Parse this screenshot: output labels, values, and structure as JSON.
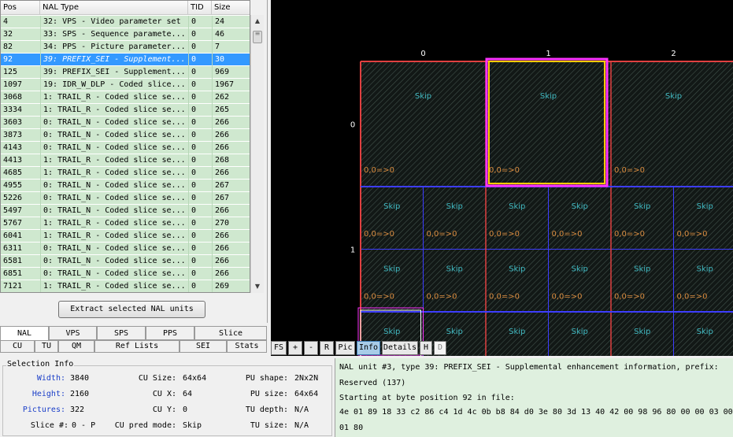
{
  "nal_table": {
    "headers": {
      "pos": "Pos",
      "type": "NAL Type",
      "tid": "TID",
      "size": "Size"
    },
    "rows": [
      {
        "pos": "4",
        "type": "32: VPS - Video parameter set",
        "tid": "0",
        "size": "24",
        "selected": false
      },
      {
        "pos": "32",
        "type": "33: SPS - Sequence paramete...",
        "tid": "0",
        "size": "46",
        "selected": false
      },
      {
        "pos": "82",
        "type": "34: PPS - Picture parameter...",
        "tid": "0",
        "size": "7",
        "selected": false
      },
      {
        "pos": "92",
        "type": "39: PREFIX_SEI - Supplement...",
        "tid": "0",
        "size": "30",
        "selected": true
      },
      {
        "pos": "125",
        "type": "39: PREFIX_SEI - Supplement...",
        "tid": "0",
        "size": "969",
        "selected": false
      },
      {
        "pos": "1097",
        "type": "19: IDR_W_DLP - Coded slice...",
        "tid": "0",
        "size": "1967",
        "selected": false
      },
      {
        "pos": "3068",
        "type": "1: TRAIL_R - Coded slice se...",
        "tid": "0",
        "size": "262",
        "selected": false
      },
      {
        "pos": "3334",
        "type": "1: TRAIL_R - Coded slice se...",
        "tid": "0",
        "size": "265",
        "selected": false
      },
      {
        "pos": "3603",
        "type": "0: TRAIL_N - Coded slice se...",
        "tid": "0",
        "size": "266",
        "selected": false
      },
      {
        "pos": "3873",
        "type": "0: TRAIL_N - Coded slice se...",
        "tid": "0",
        "size": "266",
        "selected": false
      },
      {
        "pos": "4143",
        "type": "0: TRAIL_N - Coded slice se...",
        "tid": "0",
        "size": "266",
        "selected": false
      },
      {
        "pos": "4413",
        "type": "1: TRAIL_R - Coded slice se...",
        "tid": "0",
        "size": "268",
        "selected": false
      },
      {
        "pos": "4685",
        "type": "1: TRAIL_R - Coded slice se...",
        "tid": "0",
        "size": "266",
        "selected": false
      },
      {
        "pos": "4955",
        "type": "0: TRAIL_N - Coded slice se...",
        "tid": "0",
        "size": "267",
        "selected": false
      },
      {
        "pos": "5226",
        "type": "0: TRAIL_N - Coded slice se...",
        "tid": "0",
        "size": "267",
        "selected": false
      },
      {
        "pos": "5497",
        "type": "0: TRAIL_N - Coded slice se...",
        "tid": "0",
        "size": "266",
        "selected": false
      },
      {
        "pos": "5767",
        "type": "1: TRAIL_R - Coded slice se...",
        "tid": "0",
        "size": "270",
        "selected": false
      },
      {
        "pos": "6041",
        "type": "1: TRAIL_R - Coded slice se...",
        "tid": "0",
        "size": "266",
        "selected": false
      },
      {
        "pos": "6311",
        "type": "0: TRAIL_N - Coded slice se...",
        "tid": "0",
        "size": "266",
        "selected": false
      },
      {
        "pos": "6581",
        "type": "0: TRAIL_N - Coded slice se...",
        "tid": "0",
        "size": "266",
        "selected": false
      },
      {
        "pos": "6851",
        "type": "0: TRAIL_N - Coded slice se...",
        "tid": "0",
        "size": "266",
        "selected": false
      },
      {
        "pos": "7121",
        "type": "1: TRAIL_R - Coded slice se...",
        "tid": "0",
        "size": "269",
        "selected": false
      }
    ]
  },
  "extract_button": "Extract selected NAL units",
  "tabs_row1": [
    "NAL",
    "VPS",
    "SPS",
    "PPS",
    "Slice"
  ],
  "tabs_row2": [
    "CU",
    "TU",
    "QM",
    "Ref Lists",
    "SEI",
    "Stats"
  ],
  "active_tab": "NAL",
  "selection_info": {
    "title": "Selection Info",
    "width_label": "Width:",
    "width_value": "3840",
    "height_label": "Height:",
    "height_value": "2160",
    "pictures_label": "Pictures:",
    "pictures_value": "322",
    "slice_label": "Slice #:",
    "slice_value": "0 - P",
    "cu_size_label": "CU Size:",
    "cu_size_value": "64x64",
    "cu_x_label": "CU X:",
    "cu_x_value": "64",
    "cu_y_label": "CU Y:",
    "cu_y_value": "0",
    "cu_pred_label": "CU pred mode:",
    "cu_pred_value": "Skip",
    "pu_shape_label": "PU shape:",
    "pu_shape_value": "2Nx2N",
    "pu_size_label": "PU size:",
    "pu_size_value": "64x64",
    "tu_depth_label": "TU depth:",
    "tu_depth_value": "N/A",
    "tu_size_label": "TU size:",
    "tu_size_value": "N/A"
  },
  "video_view": {
    "col_labels": [
      "0",
      "1",
      "2"
    ],
    "row_labels": [
      "0",
      "1"
    ],
    "cell_text": "Skip",
    "mv_text": "0,0=>0",
    "colors": {
      "ctu_border": "#e04040",
      "cu_border": "#3d3dff",
      "selection_outer": "#ff33ff",
      "selection_inner": "#ffcc00",
      "skip_text": "#40b8c0",
      "mv_text": "#d98c40",
      "hatch": "#40504a"
    }
  },
  "toolbar": [
    "FS",
    "+",
    "-",
    "R",
    "Pic",
    "Info",
    "Details",
    "H",
    "D"
  ],
  "toolbar_active": [
    "Info"
  ],
  "nal_info": {
    "line1": "NAL unit #3, type 39: PREFIX_SEI - Supplemental enhancement information, prefix:",
    "line2": "Reserved (137)",
    "line3": "Starting at byte position 92 in file:",
    "line4": "4e 01 89 18 33 c2 86 c4 1d 4c 0b b8 84 d0 3e 80 3d 13 40 42 00 98 96 80 00 00 03 00",
    "line5": "01 80"
  }
}
